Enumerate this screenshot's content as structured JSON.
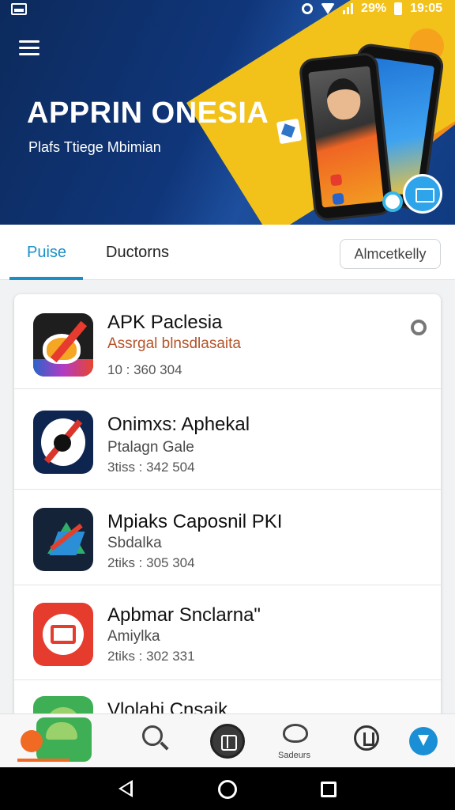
{
  "status_bar": {
    "battery_percent": "29%",
    "time": "19:05"
  },
  "hero": {
    "title": "APPRIN ONESIA",
    "subtitle": "Plafs Ttiege Mbimian"
  },
  "tabs": [
    {
      "label": "Puise",
      "selected": true
    },
    {
      "label": "Ductorns",
      "selected": false
    }
  ],
  "filter": {
    "label": "Almcetkelly"
  },
  "apps": [
    {
      "name": "APK Paclesia",
      "subtitle": "Assrgal blnsdlasaita",
      "meta": "10 : 360 304",
      "icon": "apk-speedometer-icon"
    },
    {
      "name": "Onimxs: Aphekal",
      "subtitle": "Ptalagn Gale",
      "meta": "3tiss : 342 504",
      "icon": "compass-icon"
    },
    {
      "name": "Mpiaks Caposnil PKI",
      "subtitle": "Sbdalka",
      "meta": "2tiks : 305 304",
      "icon": "play-triangle-icon"
    },
    {
      "name": "Apbmar Snclarna\"",
      "subtitle": "Amiylka",
      "meta": "2tiks : 302 331",
      "icon": "tv-icon"
    },
    {
      "name": "Vlolahi Cnsaik",
      "subtitle": "",
      "meta": "",
      "icon": "android-icon"
    }
  ],
  "bottom_nav": {
    "heart_label": "Sadeurs",
    "items": [
      "app-logo",
      "search",
      "center",
      "favorites",
      "lock",
      "profile"
    ]
  },
  "colors": {
    "accent": "#1a8fc7",
    "hero_bg": "#0f3a80",
    "hero_yellow": "#f3c21a",
    "subtitle_accent": "#b4542a"
  }
}
